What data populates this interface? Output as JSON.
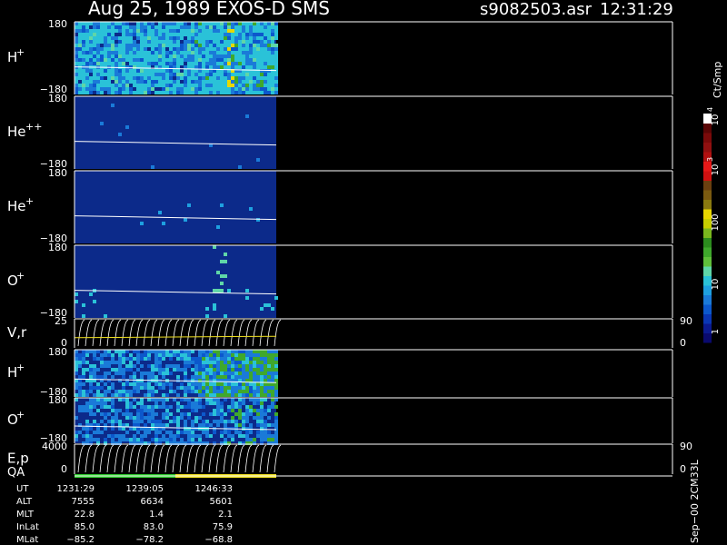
{
  "header": {
    "title": "Aug 25, 1989   EXOS-D SMS",
    "file": "s9082503.asr",
    "time": "12:31:29"
  },
  "colorbar": {
    "unit_label": "Ct/Smp",
    "tick_labels": [
      "1",
      "10",
      "100",
      "10",
      "10"
    ],
    "tick_exponents": [
      "",
      "",
      "",
      "3",
      "4"
    ],
    "colors": [
      "#0a0a6e",
      "#0b1a90",
      "#0a36b4",
      "#0c58cc",
      "#1a7ad8",
      "#1ea0e0",
      "#2ac2d8",
      "#5fd6a8",
      "#5fbf3a",
      "#3fa82c",
      "#2c8c1e",
      "#7ab81e",
      "#c8d000",
      "#e8d800",
      "#8a7a10",
      "#7a5a10",
      "#6a4010",
      "#d01010",
      "#e81818",
      "#b01010",
      "#901010",
      "#7a0a0a",
      "#5a0505",
      "#ffffff"
    ]
  },
  "panels": [
    {
      "label": "H",
      "sup": "+",
      "top": "180",
      "bottom": "−180"
    },
    {
      "label": "He",
      "sup": "++",
      "top": "180",
      "bottom": "−180"
    },
    {
      "label": "He",
      "sup": "+",
      "top": "180",
      "bottom": "−180"
    },
    {
      "label": "O",
      "sup": "+",
      "top": "180",
      "bottom": "−180"
    },
    {
      "label": "V,r",
      "sup": "",
      "top": "25",
      "bottom": "0",
      "right_top": "90",
      "right_bottom": "0"
    },
    {
      "label": "H",
      "sup": "+",
      "top": "180",
      "bottom": "−180"
    },
    {
      "label": "O",
      "sup": "+",
      "top": "180",
      "bottom": "−180"
    },
    {
      "label": "E,p",
      "sup": "",
      "top": "4000",
      "bottom": "0",
      "right_top": "90",
      "right_bottom": "0"
    }
  ],
  "qa": {
    "label": "QA",
    "segments": [
      {
        "color": "#2ecc2e",
        "fraction": 0.5
      },
      {
        "color": "#f0e020",
        "fraction": 0.5
      }
    ]
  },
  "footer": {
    "rows": [
      {
        "label": "UT",
        "values": [
          "1231:29",
          "1239:05",
          "1246:33"
        ]
      },
      {
        "label": "ALT",
        "values": [
          "7555",
          "6634",
          "5601"
        ]
      },
      {
        "label": "MLT",
        "values": [
          "22.8",
          "1.4",
          "2.1"
        ]
      },
      {
        "label": "InLat",
        "values": [
          "85.0",
          "83.0",
          "75.9"
        ]
      },
      {
        "label": "MLat",
        "values": [
          "−85.2",
          "−78.2",
          "−68.8"
        ]
      }
    ],
    "side_note": "Sep−00 2CM33L"
  },
  "chart_data": {
    "type": "heatmap",
    "title": "Aug 25, 1989   EXOS-D SMS",
    "time_labels": [
      "1231:29",
      "1239:05",
      "1246:33"
    ],
    "colorbar_unit": "Ct/Smp",
    "colorbar_ticks": [
      "1",
      "10",
      "100",
      "10^3",
      "10^4"
    ],
    "data_coverage_fraction": 0.33,
    "panels": [
      "H+",
      "He++",
      "He+",
      "O+",
      "V,r",
      "H+",
      "O+",
      "E,p"
    ]
  }
}
